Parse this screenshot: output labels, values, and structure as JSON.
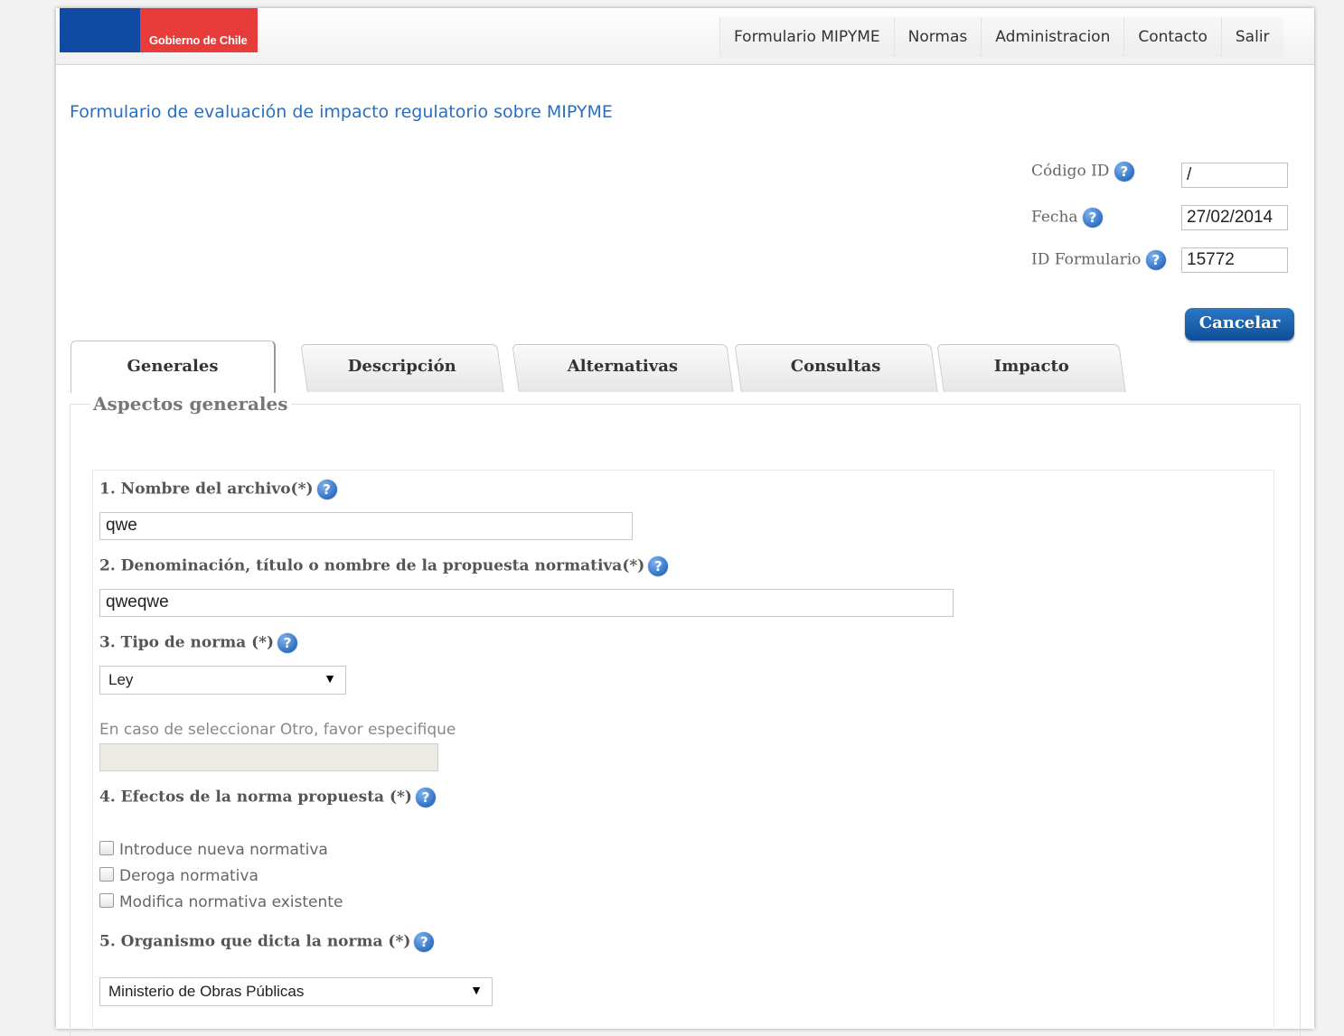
{
  "header": {
    "logo_text": "Gobierno de Chile",
    "nav": [
      "Formulario MIPYME",
      "Normas",
      "Administracion",
      "Contacto",
      "Salir"
    ]
  },
  "page_title": "Formulario de evaluación de impacto regulatorio sobre MIPYME",
  "meta": {
    "codigo_label": "Código ID",
    "codigo_value": "/",
    "fecha_label": "Fecha",
    "fecha_value": "27/02/2014",
    "idform_label": "ID Formulario",
    "idform_value": "15772"
  },
  "cancel_label": "Cancelar",
  "tabs": [
    {
      "label": "Generales",
      "active": true
    },
    {
      "label": "Descripción",
      "active": false
    },
    {
      "label": "Alternativas",
      "active": false
    },
    {
      "label": "Consultas",
      "active": false
    },
    {
      "label": "Impacto",
      "active": false
    }
  ],
  "section_title": "Aspectos generales",
  "help_glyph": "?",
  "questions": {
    "q1_label": "1. Nombre del archivo(*)",
    "q1_value": "qwe",
    "q2_label": "2. Denominación, título o nombre de la propuesta normativa(*)",
    "q2_value": "qweqwe",
    "q3_label": "3. Tipo de norma (*)",
    "q3_value": "Ley",
    "q3_hint": "En caso de seleccionar Otro, favor especifique",
    "q4_label": "4. Efectos de la norma propuesta (*)",
    "q4_options": [
      {
        "label": "Introduce nueva normativa",
        "checked": false
      },
      {
        "label": "Deroga normativa",
        "checked": false
      },
      {
        "label": "Modifica normativa existente",
        "checked": false
      }
    ],
    "q5_label": "5. Organismo que dicta la norma (*)",
    "q5_value": "Ministerio de Obras Públicas"
  },
  "dropdown_arrow": "▼"
}
